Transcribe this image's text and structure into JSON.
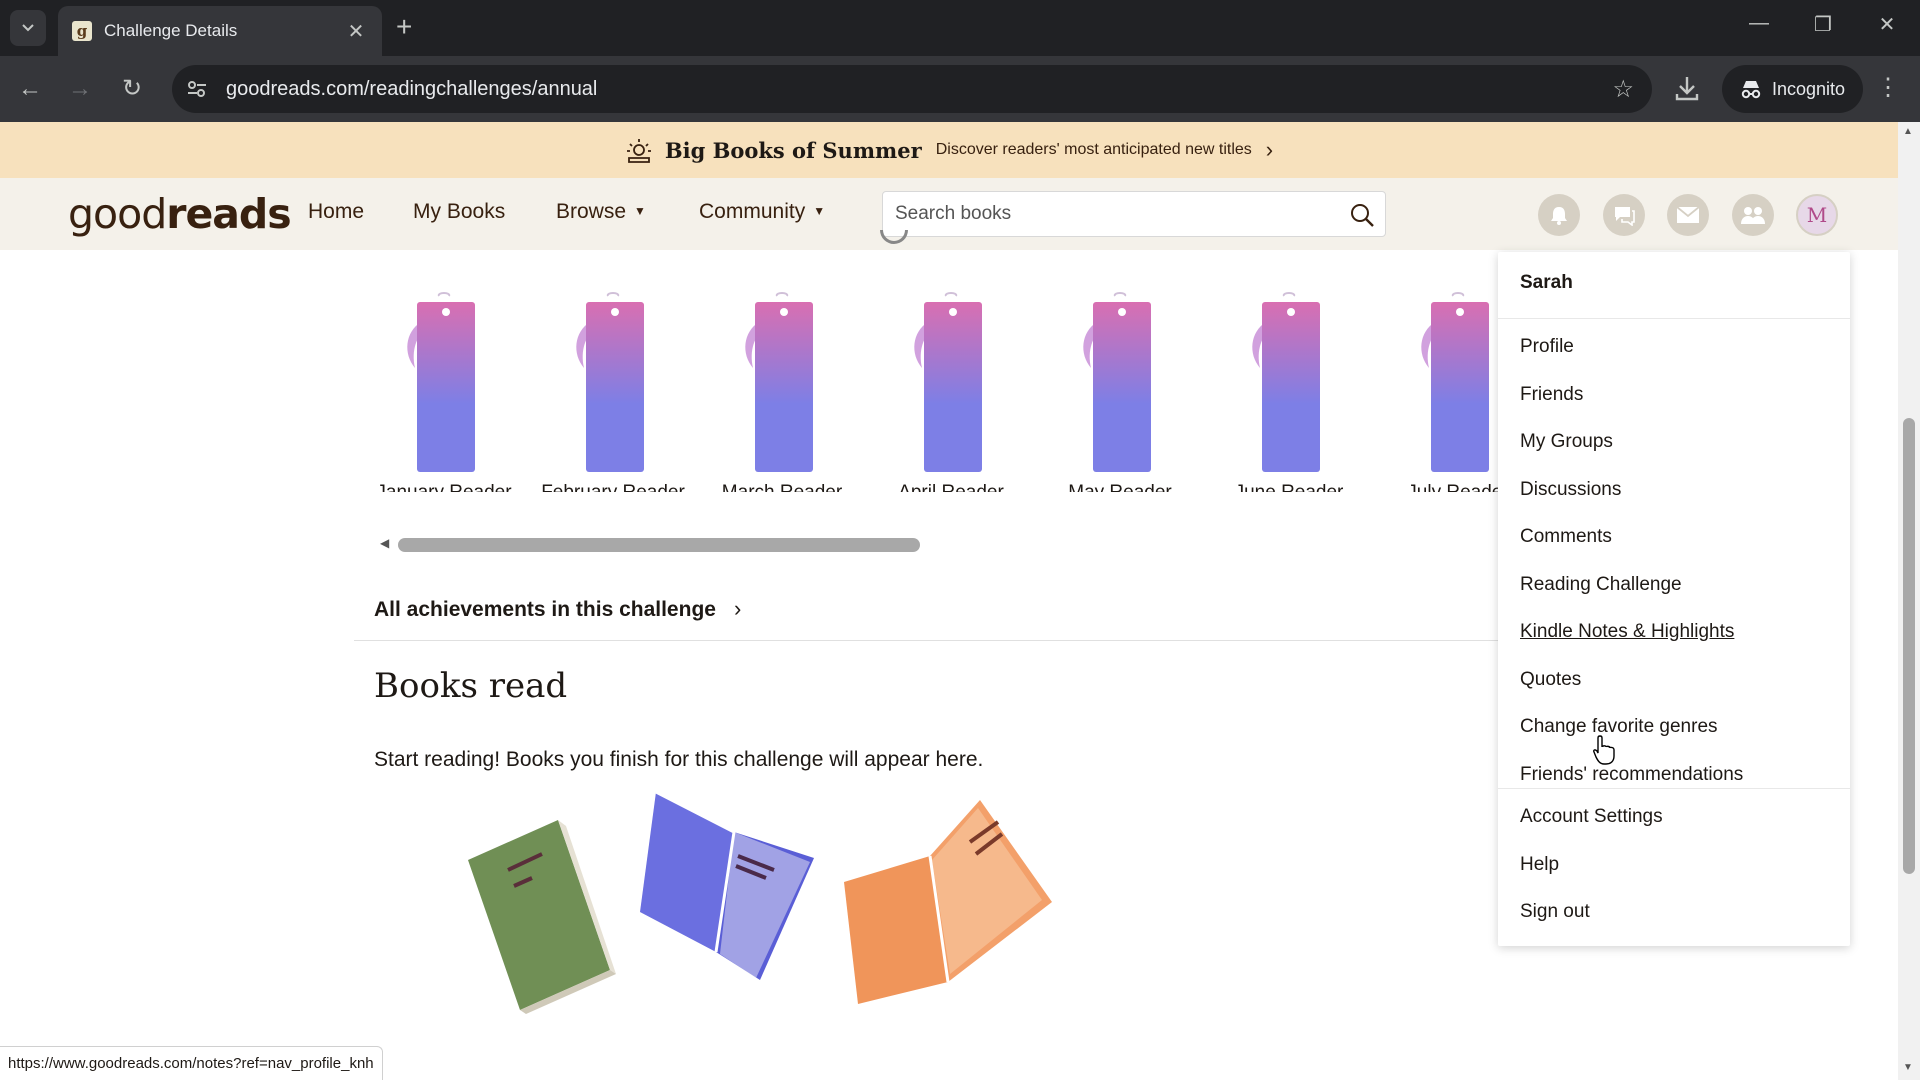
{
  "browser": {
    "tab_title": "Challenge Details",
    "url": "goodreads.com/readingchallenges/annual",
    "incognito_label": "Incognito",
    "status_url": "https://www.goodreads.com/notes?ref=nav_profile_knh"
  },
  "promo": {
    "title": "Big Books of Summer",
    "subtitle": "Discover readers' most anticipated new titles"
  },
  "header": {
    "logo_light": "good",
    "logo_bold": "reads",
    "nav": [
      "Home",
      "My Books",
      "Browse",
      "Community"
    ],
    "search_placeholder": "Search books",
    "avatar_initial": "M"
  },
  "badges": [
    "January Reader",
    "February Reader",
    "March Reader",
    "April Reader",
    "May Reader",
    "June Reader",
    "July Reader"
  ],
  "challenge": {
    "achievements_link": "All achievements in this challenge",
    "books_heading": "Books read",
    "books_empty": "Start reading! Books you finish for this challenge will appear here."
  },
  "menu": {
    "user": "Sarah",
    "group1": [
      "Profile",
      "Friends",
      "My Groups",
      "Discussions",
      "Comments",
      "Reading Challenge",
      "Kindle Notes & Highlights",
      "Quotes",
      "Change favorite genres",
      "Friends' recommendations"
    ],
    "group2": [
      "Account Settings",
      "Help",
      "Sign out"
    ],
    "hovered_item": "Kindle Notes & Highlights"
  },
  "colors": {
    "header_bg": "#f4f1ea",
    "promo_bg": "#f7e1bd",
    "brand_brown": "#382110",
    "badge_top": "#d96fb1",
    "badge_bottom": "#7d7fe6"
  }
}
